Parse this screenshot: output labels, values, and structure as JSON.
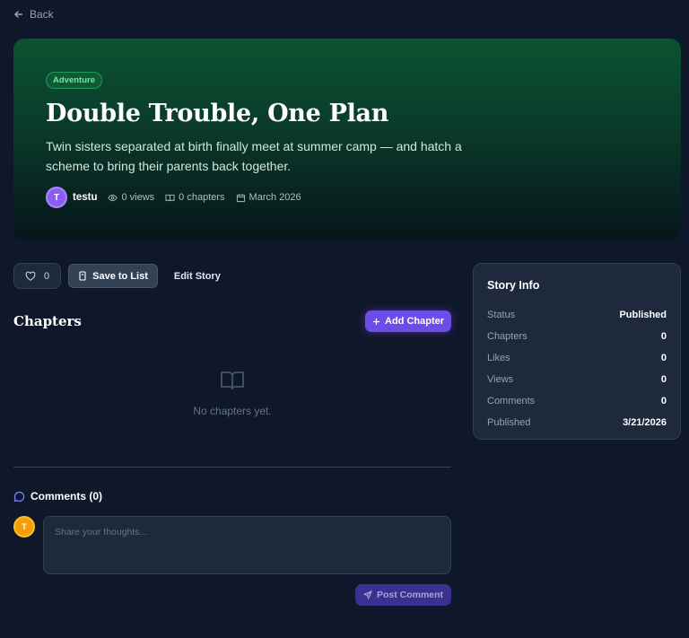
{
  "nav": {
    "back_label": "Back"
  },
  "story": {
    "genre": "Adventure",
    "title": "Double Trouble, One Plan",
    "description": "Twin sisters separated at birth finally meet at summer camp — and hatch a scheme to bring their parents back together.",
    "author_initial": "T",
    "author": "testu",
    "views": "0 views",
    "chapters": "0 chapters",
    "date": "March 2026"
  },
  "actions": {
    "likes": "0",
    "save_label": "Save to List",
    "edit_label": "Edit Story"
  },
  "chapters_section": {
    "title": "Chapters",
    "add_label": "Add Chapter",
    "empty_text": "No chapters yet."
  },
  "comments_section": {
    "title": "Comments (0)",
    "avatar_initial": "T",
    "placeholder": "Share your thoughts...",
    "post_label": "Post Comment"
  },
  "info": {
    "title": "Story Info",
    "rows": [
      {
        "label": "Status",
        "value": "Published"
      },
      {
        "label": "Chapters",
        "value": "0"
      },
      {
        "label": "Likes",
        "value": "0"
      },
      {
        "label": "Views",
        "value": "0"
      },
      {
        "label": "Comments",
        "value": "0"
      },
      {
        "label": "Published",
        "value": "3/21/2026"
      }
    ]
  },
  "colors": {
    "background": "#0f172a",
    "accent": "#6d4ce8",
    "genre_green": "#6ee7a8"
  }
}
